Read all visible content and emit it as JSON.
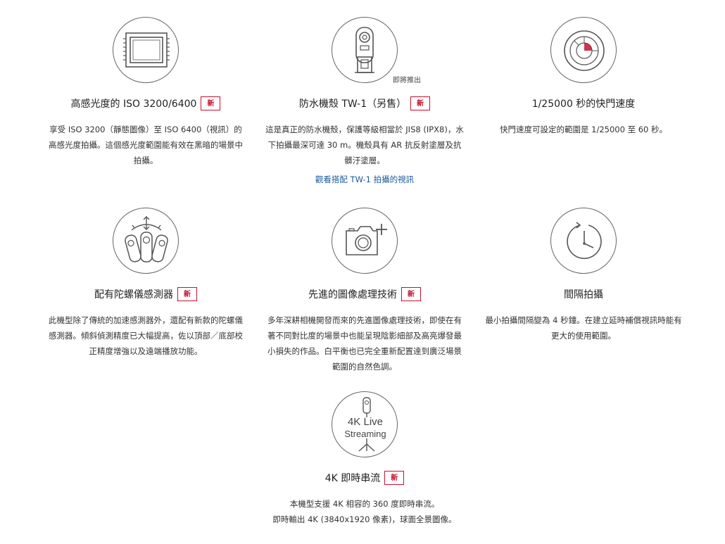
{
  "features": {
    "iso": {
      "title": "高感光度的 ISO 3200/6400",
      "badge": "新",
      "description": "享受 ISO 3200（靜態圖像）至 ISO 6400（視訊）的高感光度拍攝。這個感光度範圍能有效在黑暗的場景中拍攝。",
      "icon": "sensor-icon"
    },
    "housing": {
      "title": "防水機殼 TW-1（另售）",
      "badge": "新",
      "icon_note": "即將推出",
      "description": "這是真正的防水機殼，保護等級相當於 JIS8 (IPX8)，水下拍攝最深可達 30 m。機殼具有 AR 抗反射塗層及抗髒汙塗層。",
      "link": "觀看搭配 TW-1 拍攝的視訊",
      "icon": "waterproof-housing-icon"
    },
    "shutter": {
      "title": "1/25000 秒的快門速度",
      "description": "快門速度可設定的範圍是 1/25000 至 60 秒。",
      "icon": "shutter-icon"
    },
    "gyro": {
      "title": "配有陀螺儀感測器",
      "badge": "新",
      "description": "此機型除了傳統的加速感測器外，還配有新款的陀螺儀感測器。傾斜偵測精度已大幅提高，佐以頂部／底部校正精度增強以及遠端播放功能。",
      "icon": "gyro-sensor-icon"
    },
    "image_processing": {
      "title": "先進的圖像處理技術",
      "badge": "新",
      "description": "多年深耕相機開發而來的先進圖像處理技術，即使在有著不同對比度的場景中也能呈現陰影細部及高亮爆發最小損失的作品。白平衡也已完全重新配置達到廣泛場景範圍的自然色調。",
      "icon": "camera-plus-icon"
    },
    "interval": {
      "title": "間隔拍攝",
      "description": "最小拍攝間隔變為 4 秒鐘。在建立延時補償視訊時能有更大的使用範圍。",
      "icon": "clock-icon"
    },
    "streaming": {
      "title": "4K 即時串流",
      "badge": "新",
      "icon_text_1": "4K Live",
      "icon_text_2": "Streaming",
      "description_line1": "本機型支援 4K 相容的 360 度即時串流。",
      "description_line2": "即時輸出 4K (3840x1920 像素)，球面全景圖像。",
      "icon": "live-streaming-icon"
    }
  },
  "colors": {
    "badge": "#c8102e",
    "link": "#1b5a9c",
    "icon_stroke": "#555555"
  }
}
